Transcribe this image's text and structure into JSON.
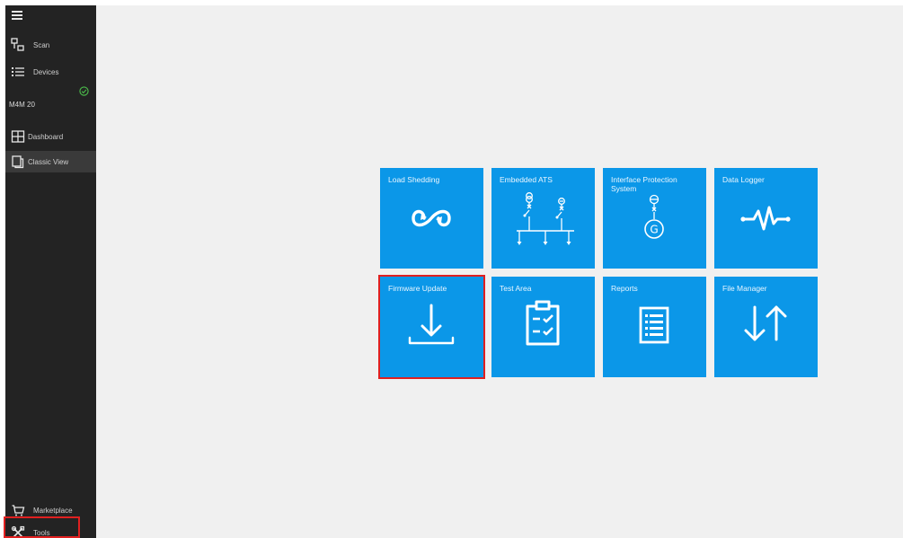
{
  "sidebar": {
    "items": [
      {
        "label": "Scan",
        "icon": "scan-icon"
      },
      {
        "label": "Devices",
        "icon": "list-icon"
      },
      {
        "label": "Dashboard",
        "icon": "grid-icon"
      },
      {
        "label": "Classic View",
        "icon": "document-icon"
      },
      {
        "label": "Marketplace",
        "icon": "cart-icon"
      },
      {
        "label": "Tools",
        "icon": "tools-icon"
      }
    ],
    "device": {
      "name": "M4M 20",
      "status": "connected",
      "status_color": "#4cc04c"
    },
    "active_item": "Classic View"
  },
  "tiles": [
    {
      "label": "Load Shedding",
      "icon": "infinity-cycle-icon"
    },
    {
      "label": "Embedded ATS",
      "icon": "single-line-diagram-icon"
    },
    {
      "label": "Interface Protection System",
      "icon": "generator-icon"
    },
    {
      "label": "Data Logger",
      "icon": "pulse-icon"
    },
    {
      "label": "Firmware Update",
      "icon": "download-icon"
    },
    {
      "label": "Test Area",
      "icon": "clipboard-check-icon"
    },
    {
      "label": "Reports",
      "icon": "report-list-icon"
    },
    {
      "label": "File Manager",
      "icon": "transfer-arrows-icon"
    }
  ],
  "selected_tile": "Firmware Update",
  "colors": {
    "tile": "#0b97e8",
    "sidebar": "#232323",
    "highlight": "#e02020",
    "background": "#f0f0f0"
  }
}
